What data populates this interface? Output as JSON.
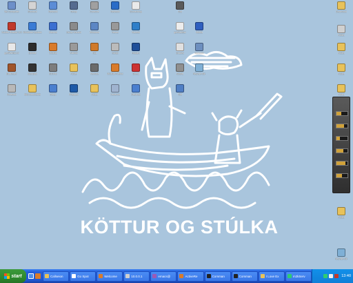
{
  "wallpaper": {
    "title": "KÖTTUR OG STÚLKA",
    "background": "#a9c5dd"
  },
  "colors": {
    "taskbar": "#245edb",
    "start": "#2f8a2f",
    "tray": "#0f7fd8"
  },
  "desktop_icons": [
    {
      "label": "My Computer",
      "color": "#6c8fc9"
    },
    {
      "label": "Adobe Reader 8.0",
      "color": "#c0392b"
    },
    {
      "label": "getWaitBar.m",
      "color": "#e8e8e8"
    },
    {
      "label": "Bitstream",
      "color": "#a0552b"
    },
    {
      "label": "Notepad",
      "color": "#b8b8b8"
    },
    {
      "label": "Shortcut",
      "color": "#d4d4d4"
    },
    {
      "label": "Windows Update",
      "color": "#3a7bd5"
    },
    {
      "label": "Update",
      "color": "#2c2c2c"
    },
    {
      "label": "Spotlight",
      "color": "#333333"
    },
    {
      "label": "My Documents",
      "color": "#e8c25a"
    },
    {
      "label": "Network",
      "color": "#5b8cd6"
    },
    {
      "label": "Internet",
      "color": "#3b6fd1"
    },
    {
      "label": "Mozilla",
      "color": "#d97b2b"
    },
    {
      "label": "BGInfo",
      "color": "#7d7d7d"
    },
    {
      "label": "Setup",
      "color": "#4a7fcf"
    },
    {
      "label": "Setup",
      "color": "#556a8f"
    },
    {
      "label": "Setup Wizard",
      "color": "#8a8a8a"
    },
    {
      "label": "Aktivist",
      "color": "#9a9a9a"
    },
    {
      "label": "Folder",
      "color": "#e8c25a"
    },
    {
      "label": "Program",
      "color": "#1e5aa8"
    },
    {
      "label": "Console",
      "color": "#a0a0a0"
    },
    {
      "label": "Windows",
      "color": "#5c86c4"
    },
    {
      "label": "Tool",
      "color": "#d07a2a"
    },
    {
      "label": "Remote",
      "color": "#6b6b6b"
    },
    {
      "label": "Folder",
      "color": "#e8c25a"
    },
    {
      "label": "Network",
      "color": "#2a6cc7"
    },
    {
      "label": "Viewer",
      "color": "#999999"
    },
    {
      "label": "Script",
      "color": "#bbbbbb"
    },
    {
      "label": "Mozilla Firefox",
      "color": "#d97b2b"
    },
    {
      "label": "Cadence",
      "color": "#9fb3cf"
    },
    {
      "label": "Something",
      "color": "#eaeaea"
    },
    {
      "label": "Access",
      "color": "#2f7fc9"
    },
    {
      "label": "Hidden",
      "color": "#1f4f99"
    },
    {
      "label": "Opera",
      "color": "#cc3333"
    },
    {
      "label": "Desktop",
      "color": "#4a7fcf"
    },
    {
      "label": "Tool",
      "color": "#5a5a5a"
    },
    {
      "label": "getWaitBar",
      "color": "#ededed"
    },
    {
      "label": "Grades",
      "color": "#e0e0e0"
    },
    {
      "label": "Scripts",
      "color": "#8f8f8f"
    },
    {
      "label": "Tool",
      "color": "#4f7ec4"
    },
    {
      "label": "Media",
      "color": "#2f5fbf"
    },
    {
      "label": "Network",
      "color": "#6d8fbf"
    },
    {
      "label": "Recycle Bin",
      "color": "#7fb0d6"
    }
  ],
  "right_icons": [
    {
      "label": "Download",
      "color": "#e8c25a"
    },
    {
      "label": "Folder",
      "color": "#cfcfcf"
    },
    {
      "label": "Folder",
      "color": "#e8c25a"
    },
    {
      "label": "Folder",
      "color": "#e8c25a"
    },
    {
      "label": "Folder",
      "color": "#e8c25a"
    },
    {
      "label": "Folder",
      "color": "#e8c25a"
    },
    {
      "label": "Recycle Bin",
      "color": "#7fb0d6"
    }
  ],
  "sidebar_meters": [
    0.45,
    0.7,
    0.3,
    0.6,
    0.8,
    0.5
  ],
  "taskbar": {
    "start_label": "start",
    "tasks": [
      {
        "label": "Callseion",
        "color": "#e8c25a"
      },
      {
        "label": "Go Spot",
        "color": "#ffffff"
      },
      {
        "label": "Welcome",
        "color": "#d97b2b"
      },
      {
        "label": "10.0.0.1",
        "color": "#d0d0d0"
      },
      {
        "label": "emacs@",
        "color": "#9b59b6"
      },
      {
        "label": "ActiveRe",
        "color": "#d97b2b"
      },
      {
        "label": "Comman",
        "color": "#222222"
      },
      {
        "label": "Comman",
        "color": "#222222"
      },
      {
        "label": "I Love Ex",
        "color": "#e8c25a"
      },
      {
        "label": "m2kServ",
        "color": "#2ecc71"
      }
    ],
    "clock": "13:40"
  }
}
